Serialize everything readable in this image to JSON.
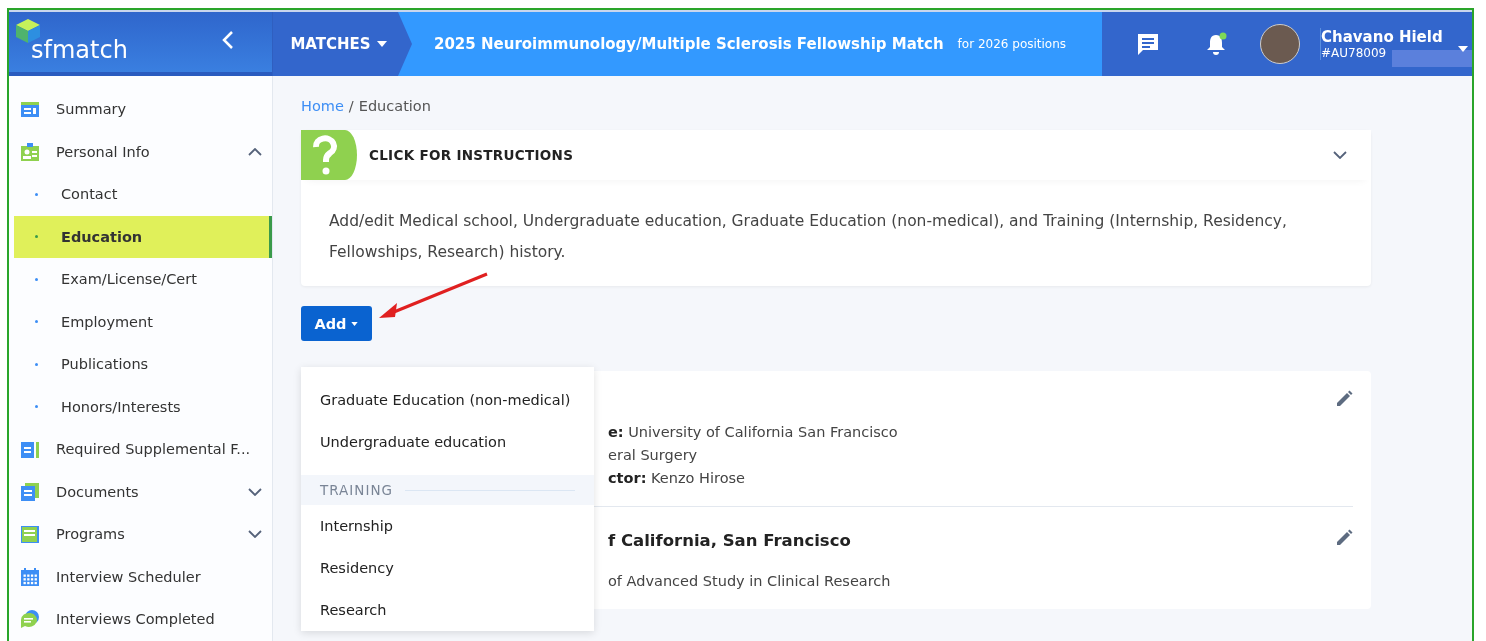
{
  "header": {
    "logo": "sfmatch",
    "matches_menu": "MATCHES",
    "match_title": "2025 Neuroimmunology/Multiple Sclerosis Fellowship Match",
    "match_subtitle": "for 2026 positions",
    "notifications_unread": true,
    "user": {
      "name": "Chavano Hield",
      "id": "#AU78009"
    }
  },
  "sidebar": {
    "items": [
      {
        "label": "Summary",
        "selected": false
      },
      {
        "label": "Personal Info",
        "selected": false,
        "expanded": true,
        "children": [
          {
            "label": "Contact",
            "selected": false
          },
          {
            "label": "Education",
            "selected": true
          },
          {
            "label": "Exam/License/Cert",
            "selected": false
          },
          {
            "label": "Employment",
            "selected": false
          },
          {
            "label": "Publications",
            "selected": false
          },
          {
            "label": "Honors/Interests",
            "selected": false
          }
        ]
      },
      {
        "label": "Required Supplemental F...",
        "selected": false
      },
      {
        "label": "Documents",
        "selected": false,
        "expanded": false
      },
      {
        "label": "Programs",
        "selected": false,
        "expanded": false
      },
      {
        "label": "Interview Scheduler",
        "selected": false
      },
      {
        "label": "Interviews Completed",
        "selected": false
      }
    ]
  },
  "breadcrumb": [
    {
      "label": "Home",
      "kind": "link"
    },
    {
      "label": "/",
      "kind": "separator"
    },
    {
      "label": "Education",
      "kind": "current"
    }
  ],
  "instructions": {
    "title": "CLICK FOR INSTRUCTIONS",
    "expanded": true,
    "text": "Add/edit Medical school, Undergraduate education, Graduate Education (non-medical), and Training (Internship, Residency, Fellowships, Research) history."
  },
  "add_button": "Add",
  "add_menu": [
    {
      "kind": "item",
      "label": "Graduate Education (non-medical)"
    },
    {
      "kind": "item",
      "label": "Undergraduate education"
    },
    {
      "kind": "header",
      "label": "TRAINING"
    },
    {
      "kind": "item",
      "label": "Internship"
    },
    {
      "kind": "item",
      "label": "Residency"
    },
    {
      "kind": "item",
      "label": "Research"
    }
  ],
  "records": [
    {
      "lines": [
        "**e:** University of California San Francisco",
        "eral Surgery",
        "**ctor:** Kenzo Hirose"
      ]
    },
    {
      "title": "f California, San Francisco",
      "lines": [
        "of Advanced Study in Clinical Research"
      ]
    }
  ]
}
